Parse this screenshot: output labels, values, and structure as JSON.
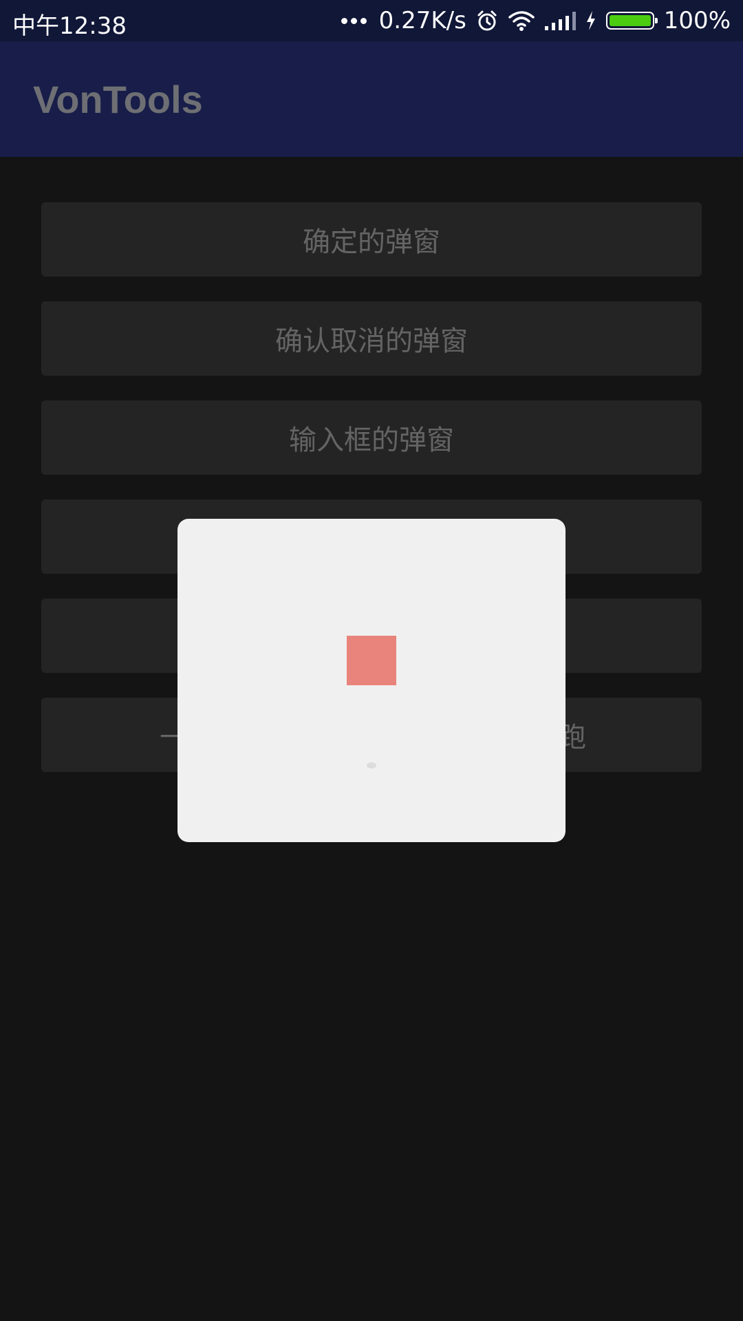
{
  "status_bar": {
    "time": "中午12:38",
    "net_speed": "0.27K/s",
    "battery_percent": "100%",
    "battery_level": 1.0,
    "icons": [
      "more-dots-icon",
      "alarm-icon",
      "wifi-icon",
      "signal-icon",
      "charging-icon",
      "battery-icon"
    ]
  },
  "app_bar": {
    "title": "VonTools"
  },
  "menu": {
    "items": [
      {
        "label": "确定的弹窗"
      },
      {
        "label": "确认取消的弹窗"
      },
      {
        "label": "输入框的弹窗"
      },
      {
        "label": ""
      },
      {
        "label": ""
      },
      {
        "label": "一",
        "label_right": "跑"
      }
    ]
  },
  "dialog": {
    "type": "loading",
    "accent_color": "#e8847b"
  },
  "colors": {
    "status_bar": "#101737",
    "app_bar": "#181e49",
    "background": "#141414",
    "button": "#242424",
    "dialog": "#f0f0f0"
  }
}
